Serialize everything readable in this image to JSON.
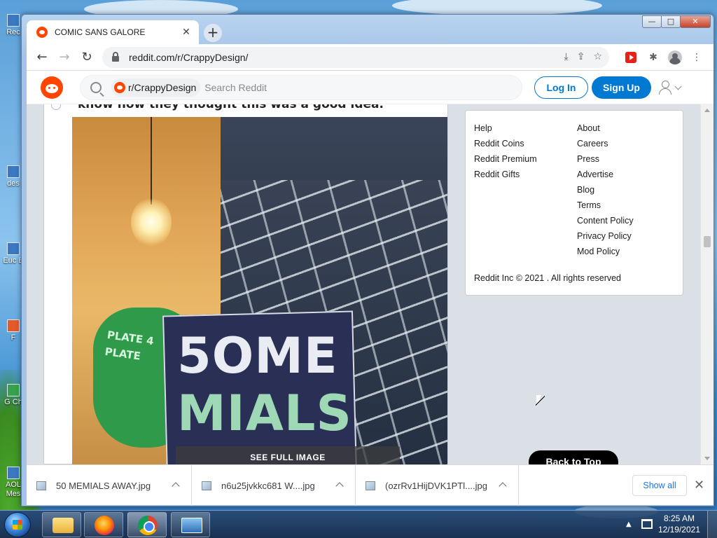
{
  "desktop": {
    "icons": [
      {
        "label": "Rec",
        "name": "recycle-bin-icon"
      },
      {
        "label": "des",
        "name": "desktop-shortcut-icon"
      },
      {
        "label": "Euc B",
        "name": "euc-shortcut-icon"
      },
      {
        "label": "F",
        "name": "f-shortcut-icon"
      },
      {
        "label": "G Ch",
        "name": "google-chrome-shortcut-icon"
      },
      {
        "label": "AOL Mes",
        "name": "aol-shortcut-icon"
      }
    ]
  },
  "browser": {
    "tab_title": "COMIC SANS GALORE",
    "url": "reddit.com/r/CrappyDesign/",
    "window_controls": {
      "minimize": "—",
      "maximize": "□",
      "close": "✕"
    }
  },
  "reddit": {
    "subreddit_chip": "r/CrappyDesign",
    "search_placeholder": "Search Reddit",
    "login_label": "Log In",
    "signup_label": "Sign Up",
    "post": {
      "title_fragment": "know how they thought this was a good idea.",
      "image_sign_top": "5OME",
      "image_sign_bottom": "MIALS",
      "image_green_sign": "PLATE 4 PLATE",
      "see_full_image": "SEE FULL IMAGE"
    },
    "footer_links_left": [
      "Help",
      "Reddit Coins",
      "Reddit Premium",
      "Reddit Gifts"
    ],
    "footer_links_right": [
      "About",
      "Careers",
      "Press",
      "Advertise",
      "Blog",
      "Terms",
      "Content Policy",
      "Privacy Policy",
      "Mod Policy"
    ],
    "copyright": "Reddit Inc © 2021 . All rights reserved",
    "back_to_top": "Back to Top"
  },
  "downloads": {
    "items": [
      {
        "name": "50 MEMIALS AWAY.jpg"
      },
      {
        "name": "n6u25jvkkc681 W....jpg"
      },
      {
        "name": "(ozrRv1HijDVK1PTl....jpg"
      }
    ],
    "show_all": "Show all"
  },
  "taskbar": {
    "time": "8:25 AM",
    "date": "12/19/2021"
  },
  "colors": {
    "reddit_orange": "#ff4500",
    "reddit_blue": "#0079d3",
    "chrome_link": "#1a73e8"
  }
}
